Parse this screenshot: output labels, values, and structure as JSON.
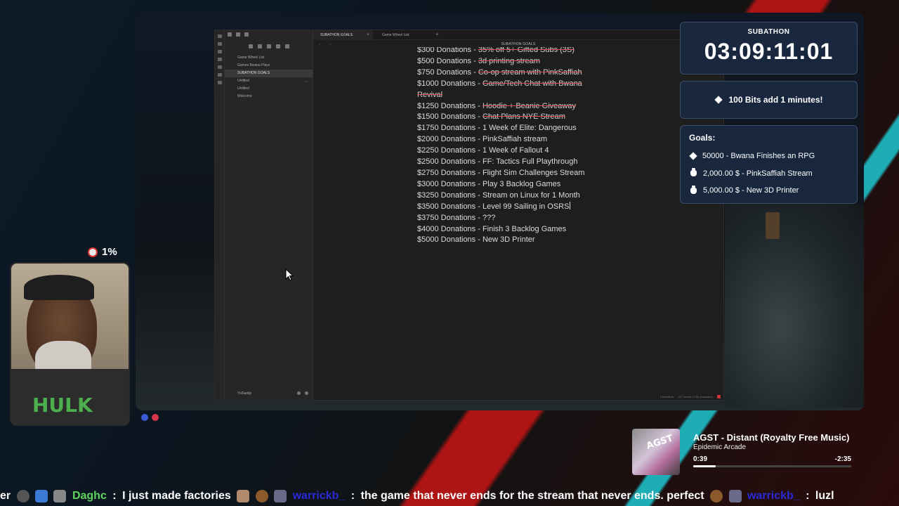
{
  "obsidian": {
    "tabs": [
      {
        "label": "SUBATHON GOALS",
        "close": "×"
      },
      {
        "label": "Game Wheel List"
      }
    ],
    "new_tab": "+",
    "note_title": "SUBATHON GOALS",
    "files": [
      {
        "label": "Game Wheel List"
      },
      {
        "label": "Games Bwana Plays"
      },
      {
        "label": "SUBATHON GOALS"
      },
      {
        "label": "Untitled",
        "meta": "∞∞"
      },
      {
        "label": "Untitled"
      },
      {
        "label": "Welcome"
      }
    ],
    "vault": "YoDaddy",
    "status": {
      "backlinks": "0 backlinks",
      "counts": "227 words 1,152 characters"
    },
    "lines": [
      {
        "text": "$300 Donations - ",
        "done": "35% off 5+ Gifted Subs (3S)"
      },
      {
        "text": "$500 Donations - ",
        "done": "3d printing stream"
      },
      {
        "text": "$750 Donations - ",
        "done": "Co-op stream with PinkSaffiah"
      },
      {
        "text": "$1000 Donations - ",
        "done": "Game/Tech Chat with Bwana Revival"
      },
      {
        "text": "$1250 Donations - ",
        "done": "Hoodie + Beanie Giveaway"
      },
      {
        "text": "$1500 Donations - ",
        "done": "Chat Plans NYE Stream"
      },
      {
        "text": "$1750 Donations - 1 Week of Elite: Dangerous"
      },
      {
        "text": "$2000 Donations - PinkSaffiah stream"
      },
      {
        "text": "$2250 Donations - 1 Week of Fallout 4"
      },
      {
        "text": "$2500 Donations - FF: Tactics Full Playthrough"
      },
      {
        "text": "$2750 Donations - Flight Sim Challenges Stream"
      },
      {
        "text": "$3000 Donations - Play 3 Backlog Games"
      },
      {
        "text": "$3250 Donations - Stream on Linux for 1 Month"
      },
      {
        "text": "$3500 Donations - Level 99 Sailing in OSRS"
      },
      {
        "text": "$3750 Donations - ???"
      },
      {
        "text": "$4000 Donations - Finish 3 Backlog Games"
      },
      {
        "text": "$5000 Donations - New 3D Printer"
      }
    ]
  },
  "overlay": {
    "timer_label": "SUBATHON",
    "timer_value": "03:09:11:01",
    "bits_text": "100 Bits add 1 minutes!",
    "goals_title": "Goals:",
    "goals": [
      {
        "icon": "diamond-icon",
        "text": "50000 - Bwana Finishes an RPG"
      },
      {
        "icon": "money-bag-icon",
        "text": "2,000.00 $ - PinkSaffiah Stream"
      },
      {
        "icon": "money-bag-icon",
        "text": "5,000.00 $ - New 3D Printer"
      }
    ],
    "percent": "1%"
  },
  "music": {
    "album_tag": "AGST",
    "title": "AGST - Distant (Royalty Free Music)",
    "artist": "Epidemic Arcade",
    "elapsed": "0:39",
    "remaining": "-2:35",
    "progress": 0.14
  },
  "chat": {
    "lead": "er",
    "user1": "Daghc",
    "msg1": "I just made factories",
    "user2": "warrickb_",
    "msg2": "the game that never ends for the stream that never ends. perfect",
    "user3": "warrickb_",
    "msg3": "luzl"
  },
  "colors": {
    "accent_strike": "#e05050",
    "panel": "#1a2a42",
    "chat_user1": "#5fd35f",
    "chat_user2": "#2a2ad8"
  }
}
